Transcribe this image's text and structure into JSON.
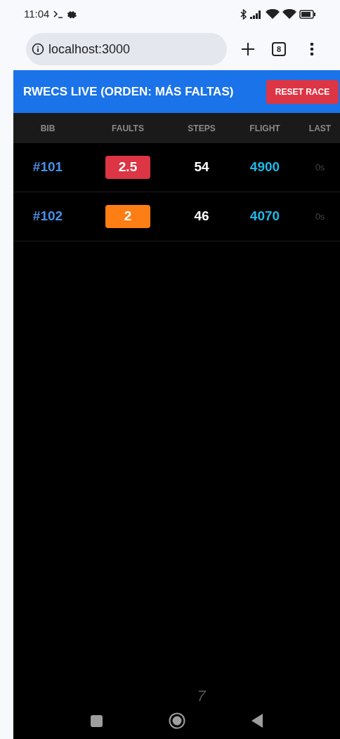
{
  "status_bar": {
    "time": "11:04"
  },
  "browser": {
    "url": "localhost:3000",
    "tab_count": "8"
  },
  "header": {
    "title": "RWECS LIVE (ORDEN: MÁS FALTAS)",
    "button": "RESET RACE"
  },
  "table": {
    "columns": [
      "BIB",
      "FAULTS",
      "STEPS",
      "FLIGHT",
      "LAST"
    ],
    "rows": [
      {
        "bib": "#101",
        "faults": "2.5",
        "color": "#dc3545",
        "steps": "54",
        "flight": "4900",
        "last": "0s"
      },
      {
        "bib": "#102",
        "faults": "2",
        "color": "#fd7e14",
        "steps": "46",
        "flight": "4070",
        "last": "0s"
      }
    ]
  },
  "footer_text": "7"
}
